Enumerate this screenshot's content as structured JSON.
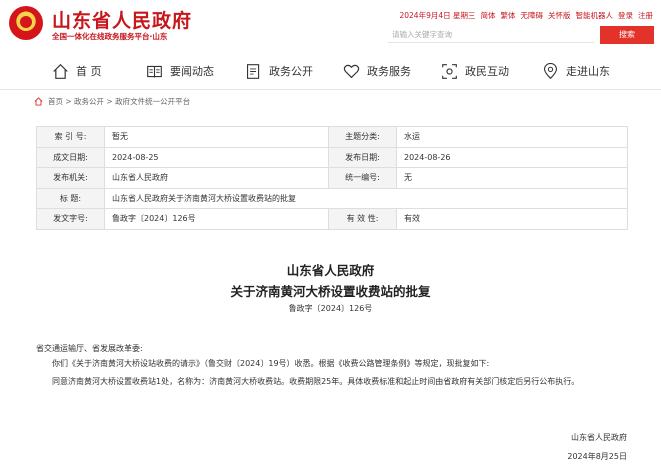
{
  "header": {
    "title": "山东省人民政府",
    "subtitle": "全国一体化在线政务服务平台·山东",
    "top_links": [
      "2024年9月4日 星期三",
      "简体",
      "繁体",
      "无障碍",
      "关怀版",
      "智能机器人",
      "登录",
      "注册"
    ],
    "search_placeholder": "请输入关键字查询",
    "search_button": "搜索"
  },
  "nav": {
    "items": [
      {
        "label": "首 页",
        "icon": "home-icon"
      },
      {
        "label": "要闻动态",
        "icon": "news-icon"
      },
      {
        "label": "政务公开",
        "icon": "document-icon"
      },
      {
        "label": "政务服务",
        "icon": "heart-icon"
      },
      {
        "label": "政民互动",
        "icon": "interaction-icon"
      },
      {
        "label": "走进山东",
        "icon": "location-icon"
      }
    ]
  },
  "breadcrumb": "首页 > 政务公开 > 政府文件统一公开平台",
  "info": {
    "index_label": "索 引 号:",
    "index_value": "暂无",
    "category_label": "主题分类:",
    "category_value": "水运",
    "created_label": "成文日期:",
    "created_value": "2024-08-25",
    "published_label": "发布日期:",
    "published_value": "2024-08-26",
    "issuer_label": "发布机关:",
    "issuer_value": "山东省人民政府",
    "serial_label": "统一编号:",
    "serial_value": "无",
    "title_label": "标    题:",
    "title_value": "山东省人民政府关于济南黄河大桥设置收费站的批复",
    "doc_no_label": "发文字号:",
    "doc_no_value": "鲁政字〔2024〕126号",
    "validity_label": "有 效 性:",
    "validity_value": "有效"
  },
  "document": {
    "issuer": "山东省人民政府",
    "title": "关于济南黄河大桥设置收费站的批复",
    "number": "鲁政字〔2024〕126号",
    "recipient": "省交通运输厅、省发展改革委:",
    "para1": "你们《关于济南黄河大桥设站收费的请示》（鲁交财〔2024〕19号）收悉。根据《收费公路管理条例》等规定，现批复如下:",
    "para2": "同意济南黄河大桥设置收费站1处，名称为：济南黄河大桥收费站。收费期限25年。具体收费标准和起止时间由省政府有关部门核定后另行公布执行。",
    "sign_org": "山东省人民政府",
    "sign_date": "2024年8月25日"
  },
  "colors": {
    "brand_red": "#c8161d",
    "button_red": "#e2322a"
  }
}
